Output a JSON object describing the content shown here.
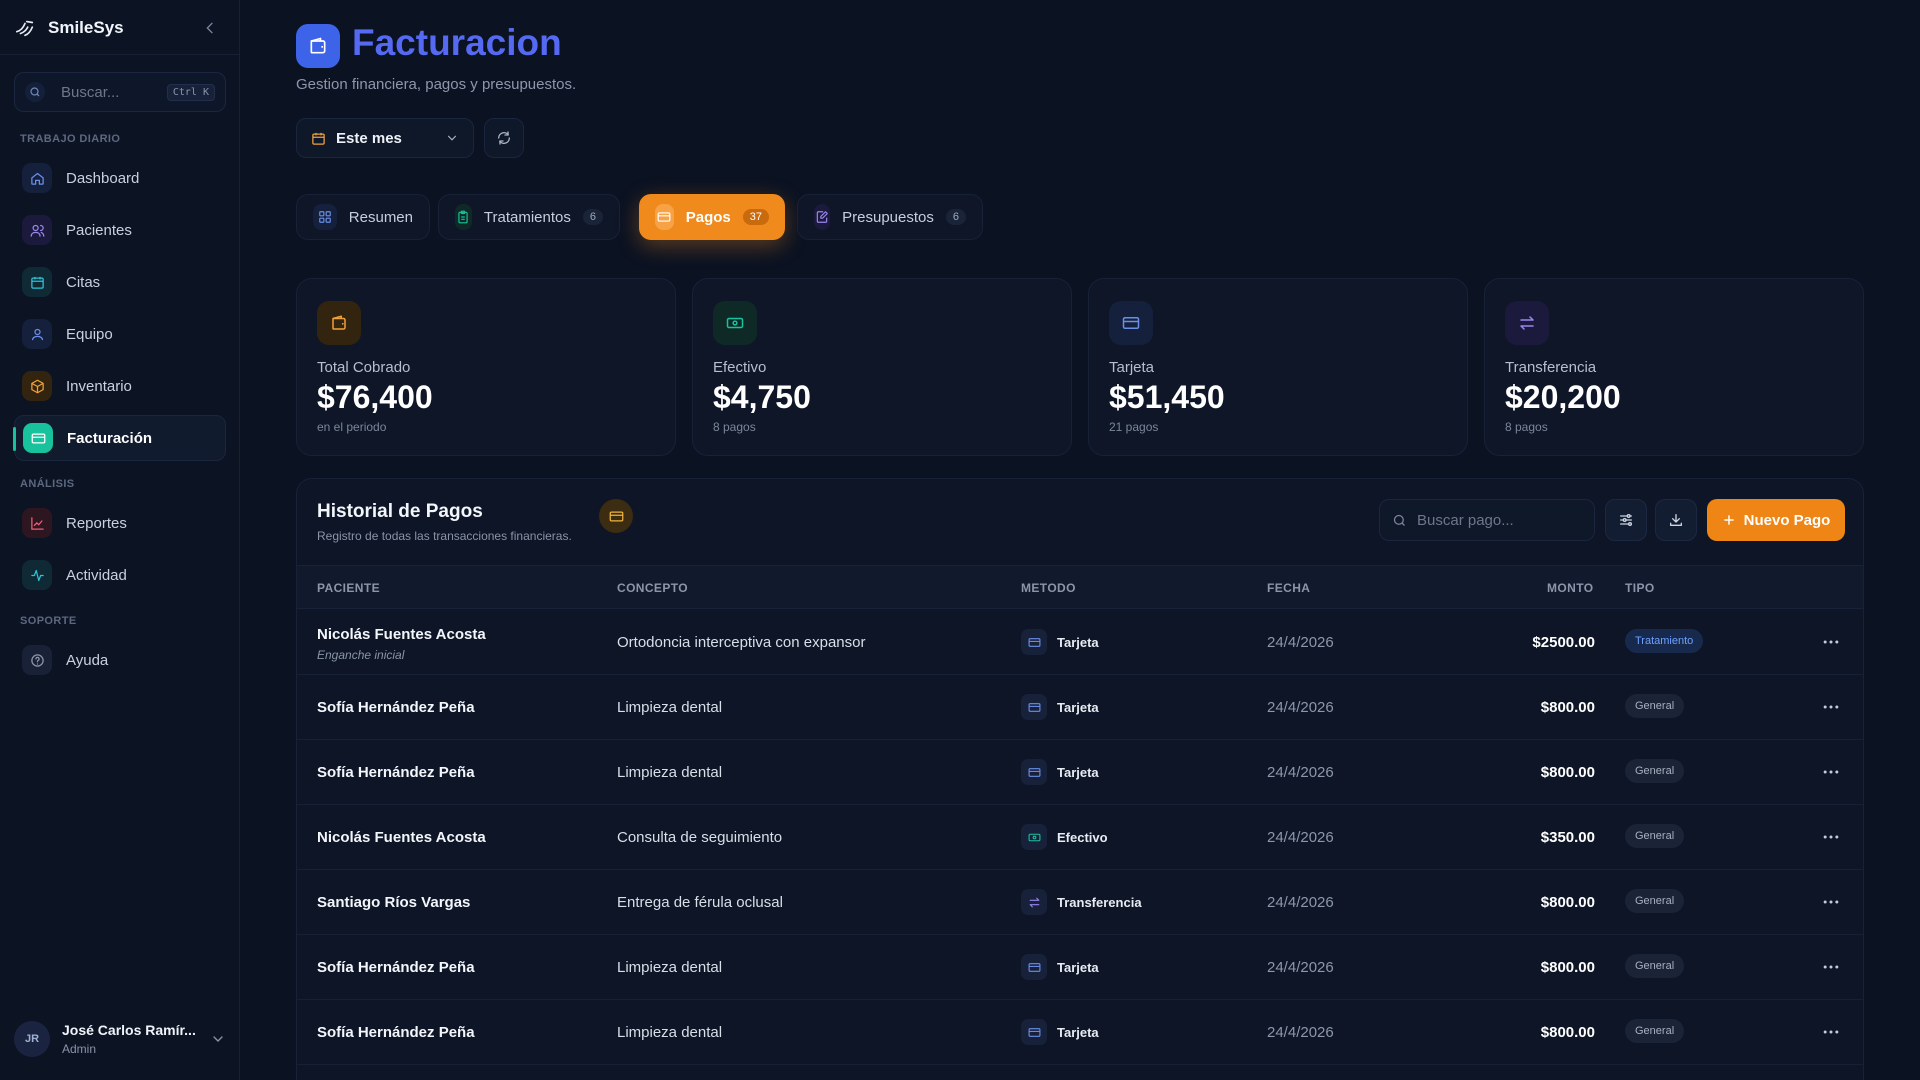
{
  "app": {
    "name": "SmileSys"
  },
  "search": {
    "placeholder": "Buscar...",
    "shortcut": "Ctrl K"
  },
  "sidebar": {
    "sections": [
      {
        "label": "TRABAJO DIARIO"
      },
      {
        "label": "ANÁLISIS"
      },
      {
        "label": "SOPORTE"
      }
    ],
    "items": [
      {
        "label": "Dashboard"
      },
      {
        "label": "Pacientes"
      },
      {
        "label": "Citas"
      },
      {
        "label": "Equipo"
      },
      {
        "label": "Inventario"
      },
      {
        "label": "Facturación"
      },
      {
        "label": "Reportes"
      },
      {
        "label": "Actividad"
      },
      {
        "label": "Ayuda"
      }
    ]
  },
  "user": {
    "initials": "JR",
    "name": "José Carlos Ramír...",
    "role": "Admin"
  },
  "page": {
    "title": "Facturacion",
    "subtitle": "Gestion financiera, pagos y presupuestos."
  },
  "filters": {
    "period": "Este mes"
  },
  "tabs": [
    {
      "label": "Resumen",
      "count": ""
    },
    {
      "label": "Tratamientos",
      "count": "6"
    },
    {
      "label": "Pagos",
      "count": "37"
    },
    {
      "label": "Presupuestos",
      "count": "6"
    }
  ],
  "stats": [
    {
      "label": "Total Cobrado",
      "value": "$76,400",
      "sub": "en el periodo"
    },
    {
      "label": "Efectivo",
      "value": "$4,750",
      "sub": "8 pagos"
    },
    {
      "label": "Tarjeta",
      "value": "$51,450",
      "sub": "21 pagos"
    },
    {
      "label": "Transferencia",
      "value": "$20,200",
      "sub": "8 pagos"
    }
  ],
  "history": {
    "title": "Historial de Pagos",
    "subtitle": "Registro de todas las transacciones financieras.",
    "search_placeholder": "Buscar pago...",
    "new_label": "Nuevo Pago",
    "columns": [
      "PACIENTE",
      "CONCEPTO",
      "METODO",
      "FECHA",
      "MONTO",
      "TIPO"
    ],
    "rows": [
      {
        "patient": "Nicolás Fuentes Acosta",
        "note": "Enganche inicial",
        "concept": "Ortodoncia interceptiva con expansor",
        "method": "Tarjeta",
        "date": "24/4/2026",
        "amount": "$2500.00",
        "type": "Tratamiento"
      },
      {
        "patient": "Sofía Hernández Peña",
        "note": "",
        "concept": "Limpieza dental",
        "method": "Tarjeta",
        "date": "24/4/2026",
        "amount": "$800.00",
        "type": "General"
      },
      {
        "patient": "Sofía Hernández Peña",
        "note": "",
        "concept": "Limpieza dental",
        "method": "Tarjeta",
        "date": "24/4/2026",
        "amount": "$800.00",
        "type": "General"
      },
      {
        "patient": "Nicolás Fuentes Acosta",
        "note": "",
        "concept": "Consulta de seguimiento",
        "method": "Efectivo",
        "date": "24/4/2026",
        "amount": "$350.00",
        "type": "General"
      },
      {
        "patient": "Santiago Ríos Vargas",
        "note": "",
        "concept": "Entrega de férula oclusal",
        "method": "Transferencia",
        "date": "24/4/2026",
        "amount": "$800.00",
        "type": "General"
      },
      {
        "patient": "Sofía Hernández Peña",
        "note": "",
        "concept": "Limpieza dental",
        "method": "Tarjeta",
        "date": "24/4/2026",
        "amount": "$800.00",
        "type": "General"
      },
      {
        "patient": "Sofía Hernández Peña",
        "note": "",
        "concept": "Limpieza dental",
        "method": "Tarjeta",
        "date": "24/4/2026",
        "amount": "$800.00",
        "type": "General"
      }
    ]
  },
  "colors": {
    "accent_orange": "#ee8514",
    "accent_blue": "#5569f3",
    "accent_green": "#18c29c",
    "bg": "#0b1222"
  }
}
